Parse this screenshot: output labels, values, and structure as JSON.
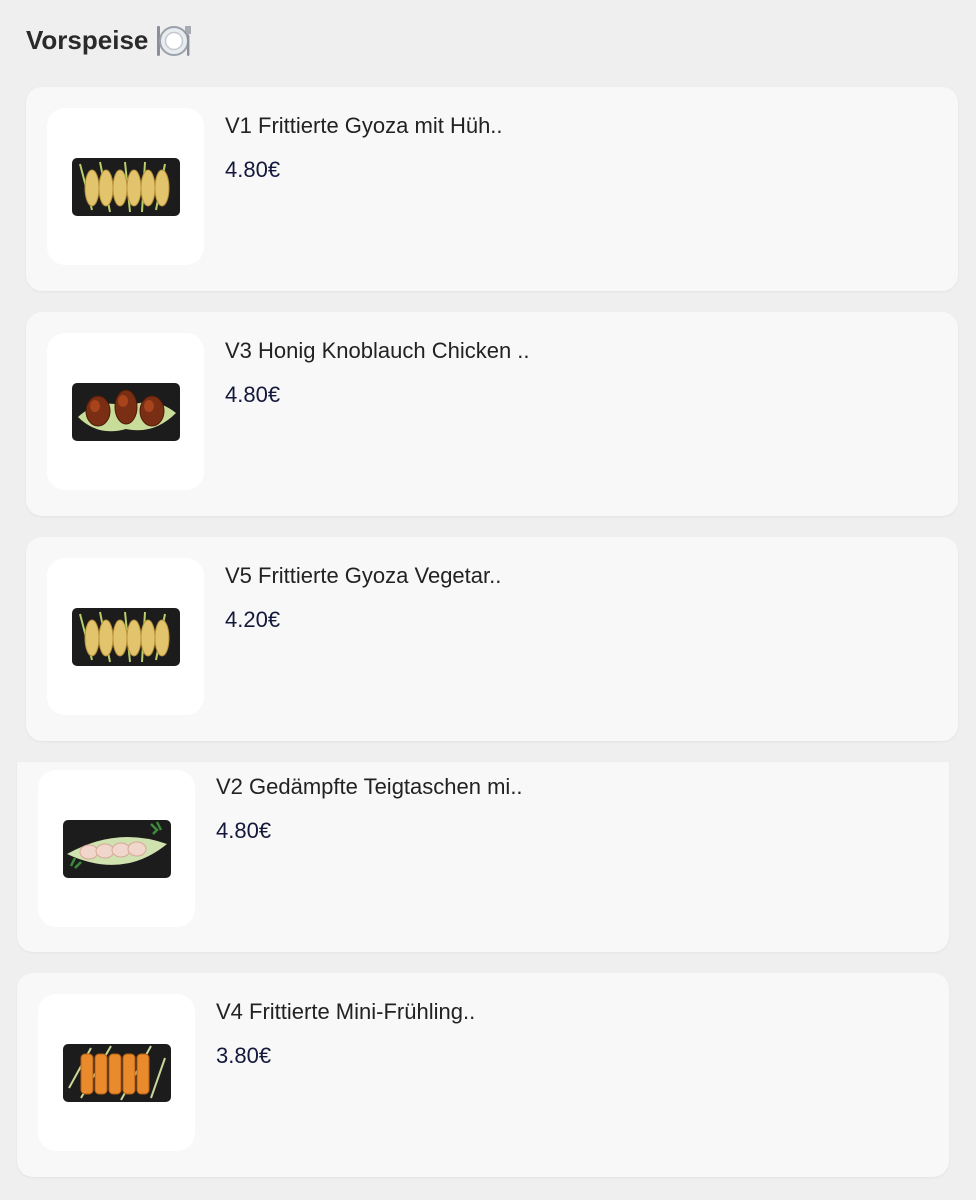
{
  "section": {
    "title": "Vorspeise",
    "icon": "plate-cutlery-icon"
  },
  "items": [
    {
      "name": "V1 Frittierte Gyoza mit Hüh..",
      "price": "4.80€",
      "image": "gyoza-dish-icon"
    },
    {
      "name": "V3 Honig Knoblauch Chicken ..",
      "price": "4.80€",
      "image": "chicken-wings-dish-icon"
    },
    {
      "name": "V5 Frittierte Gyoza Vegetar..",
      "price": "4.20€",
      "image": "gyoza-dish-icon"
    },
    {
      "name": "V2 Gedämpfte Teigtaschen mi..",
      "price": "4.80€",
      "image": "dumplings-dish-icon"
    },
    {
      "name": "V4 Frittierte Mini-Frühling..",
      "price": "3.80€",
      "image": "spring-rolls-dish-icon"
    }
  ],
  "colors": {
    "background": "#efefef",
    "card": "#f8f8f8",
    "price": "#14183a"
  }
}
